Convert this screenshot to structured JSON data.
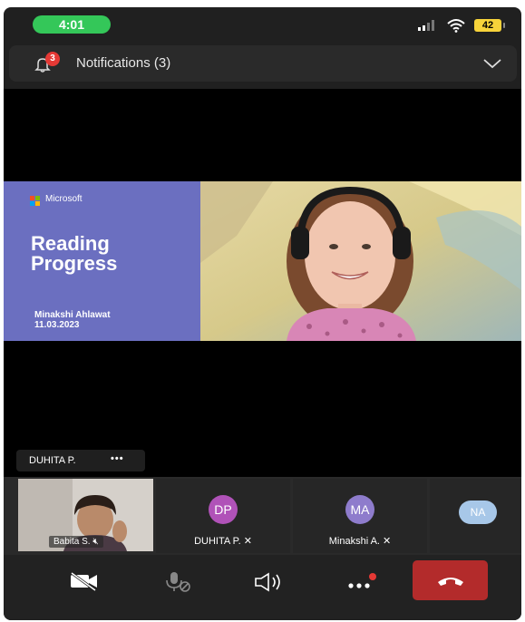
{
  "status_bar": {
    "time": "4:01",
    "battery": "42",
    "colors": {
      "time_pill": "#34c759",
      "battery": "#f7d33a"
    }
  },
  "notifications": {
    "label": "Notifications (3)",
    "badge_count": "3",
    "icons": [
      "bell-icon",
      "chevron-down-icon"
    ]
  },
  "shared_content": {
    "slide": {
      "brand": "Microsoft",
      "title_line1": "Reading",
      "title_line2": "Progress",
      "author": "Minakshi Ahlawat",
      "date": "11.03.2023",
      "background": "#6b6fc0"
    },
    "speaker_label": "DUHITA P.",
    "more_label": "•••"
  },
  "participants": [
    {
      "name": "Babita S.",
      "type": "video",
      "muted": true
    },
    {
      "name": "DUHITA P.",
      "initials": "DP",
      "avatar_color": "#b052b8",
      "muted": true
    },
    {
      "name": "Minakshi A.",
      "initials": "MA",
      "avatar_color": "#8e7ccc",
      "muted": true
    },
    {
      "name": "",
      "initials": "NA",
      "avatar_color": "#a7c7e8",
      "muted": false
    }
  ],
  "controls": {
    "items": [
      "camera-off-icon",
      "mic-off-icon",
      "speaker-icon",
      "more-icon",
      "end-call-icon"
    ],
    "end_call_color": "#b32b2b"
  }
}
